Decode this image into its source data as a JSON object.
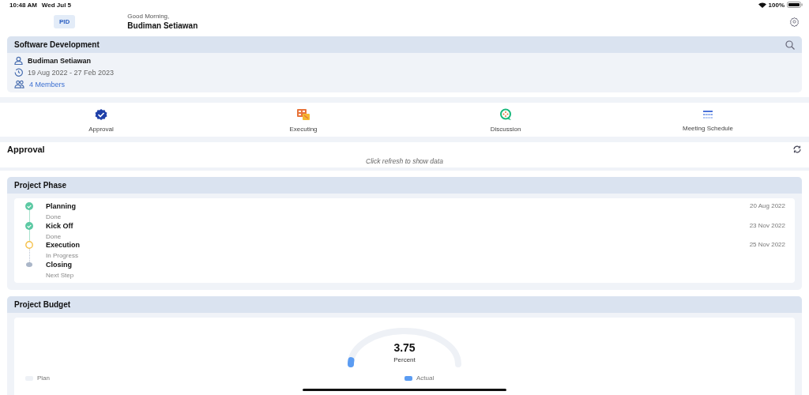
{
  "status_bar": {
    "time": "10:48 AM",
    "date": "Wed Jul 5",
    "battery_text": "100%"
  },
  "header": {
    "badge": "PID",
    "greeting": "Good Morning,",
    "user": "Budiman Setiawan"
  },
  "project": {
    "title": "Software Development",
    "owner": "Budiman Setiawan",
    "period": "19 Aug 2022 - 27 Feb 2023",
    "members": "4 Members"
  },
  "menu": [
    {
      "label": "Approval"
    },
    {
      "label": "Executing"
    },
    {
      "label": "Discussion"
    },
    {
      "label": "Meeting Schedule"
    }
  ],
  "approval": {
    "title": "Approval",
    "message": "Click refresh to show data"
  },
  "project_phase": {
    "title": "Project Phase",
    "phases": [
      {
        "name": "Planning",
        "status_text": "Done",
        "date": "20 Aug 2022",
        "kind": "done"
      },
      {
        "name": "Kick Off",
        "status_text": "Done",
        "date": "23 Nov 2022",
        "kind": "done"
      },
      {
        "name": "Execution",
        "status_text": "In Progress",
        "date": "25 Nov 2022",
        "kind": "progress"
      },
      {
        "name": "Closing",
        "status_text": "Next Step",
        "kind": "next"
      }
    ]
  },
  "project_budget": {
    "title": "Project Budget",
    "gauge": {
      "value": "3.75",
      "unit": "Percent",
      "level": 0.0375
    },
    "legend": [
      {
        "label": "Plan",
        "color": "#eef1f6"
      },
      {
        "label": "Actual",
        "color": "#5b9cf2"
      }
    ]
  }
}
